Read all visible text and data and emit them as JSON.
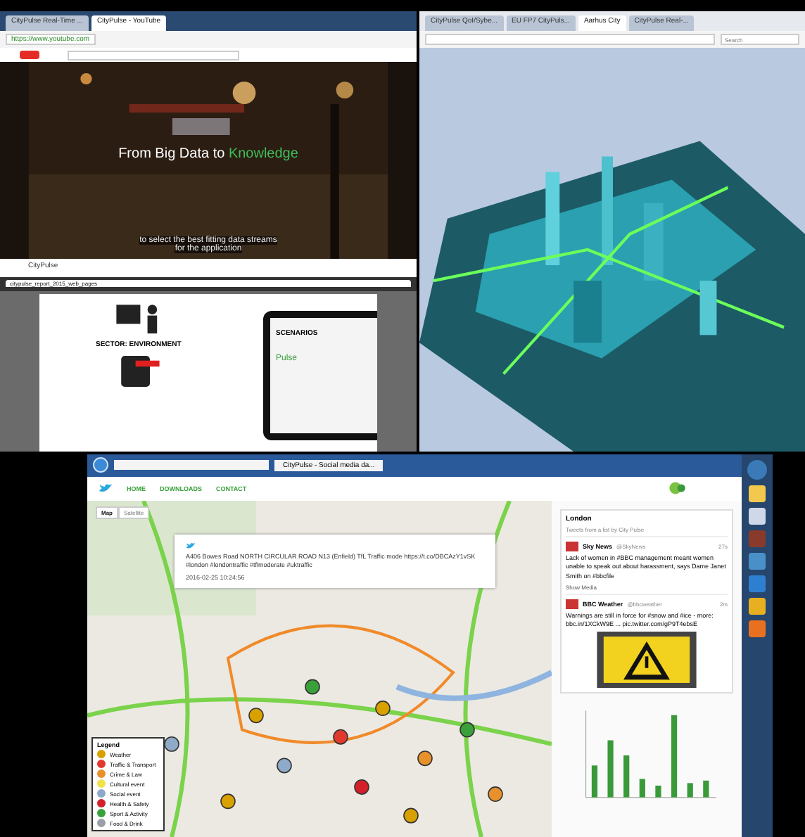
{
  "video_window": {
    "tabs": [
      {
        "label": "CityPulse Real-Time ...",
        "selected": false
      },
      {
        "label": "CityPulse - YouTube",
        "selected": true
      }
    ],
    "address": "https://www.youtube.com",
    "video_title_lead": "From Big Data to ",
    "video_title_highlight": "Knowledge",
    "subtitle_lines": [
      "to select the best fitting data streams",
      "for the application"
    ],
    "channel": "CityPulse"
  },
  "pdf_viewer": {
    "tab": "citypulse_report_2015_web_pages",
    "sector_title": "SECTOR: ENVIRONMENT",
    "scenarios_label": "SCENARIOS",
    "logo_text": "Pulse"
  },
  "city_window": {
    "tabs": [
      {
        "label": "CityPulse QoI/Sybe...",
        "selected": false
      },
      {
        "label": "EU FP7 CityPuls...",
        "selected": false
      },
      {
        "label": "Aarhus City",
        "selected": true
      },
      {
        "label": "CityPulse Real-...",
        "selected": false
      }
    ],
    "search_placeholder": "Search"
  },
  "dashboard_window": {
    "tab": "CityPulse - Social media da...",
    "nav": [
      {
        "label": "HOME"
      },
      {
        "label": "DOWNLOADS"
      },
      {
        "label": "CONTACT"
      }
    ],
    "map_types": [
      {
        "label": "Map",
        "selected": true
      },
      {
        "label": "Satellite",
        "selected": false
      }
    ],
    "popup": {
      "text": "A406 Bowes Road NORTH CIRCULAR ROAD N13 (Enfield) TfL Traffic mode https://t.co/DBCAzY1vSK #london #londontraffic #tflmoderate #uktraffic",
      "time": "2016-02-25 10:24:56"
    },
    "legend": {
      "title": "Legend",
      "items": [
        {
          "label": "Weather",
          "color": "#d9a100"
        },
        {
          "label": "Traffic & Transport",
          "color": "#e03a2f"
        },
        {
          "label": "Crime & Law",
          "color": "#e8912c"
        },
        {
          "label": "Cultural event",
          "color": "#f2e24a"
        },
        {
          "label": "Social event",
          "color": "#8fa9c9"
        },
        {
          "label": "Health & Safety",
          "color": "#d4202a"
        },
        {
          "label": "Sport & Activity",
          "color": "#3aa13a"
        },
        {
          "label": "Food & Drink",
          "color": "#9aa0a8"
        }
      ]
    },
    "timeline": {
      "title": "London",
      "subtitle": "Tweets from a list by City Pulse",
      "tweets": [
        {
          "author": "Sky News",
          "handle": "@SkyNews",
          "age": "27s",
          "text": "Lack of women in #BBC management meant women unable to speak out about harassment, says Dame Janet Smith on #bbcfile",
          "media": "Show Media",
          "has_image": false
        },
        {
          "author": "BBC Weather",
          "handle": "@bbcweather",
          "age": "2m",
          "text": "Warnings are still in force for #snow and #ice - more: bbc.in/1XCkW9E ... pic.twitter.com/gP9T4ebsE",
          "has_image": true
        }
      ]
    }
  }
}
